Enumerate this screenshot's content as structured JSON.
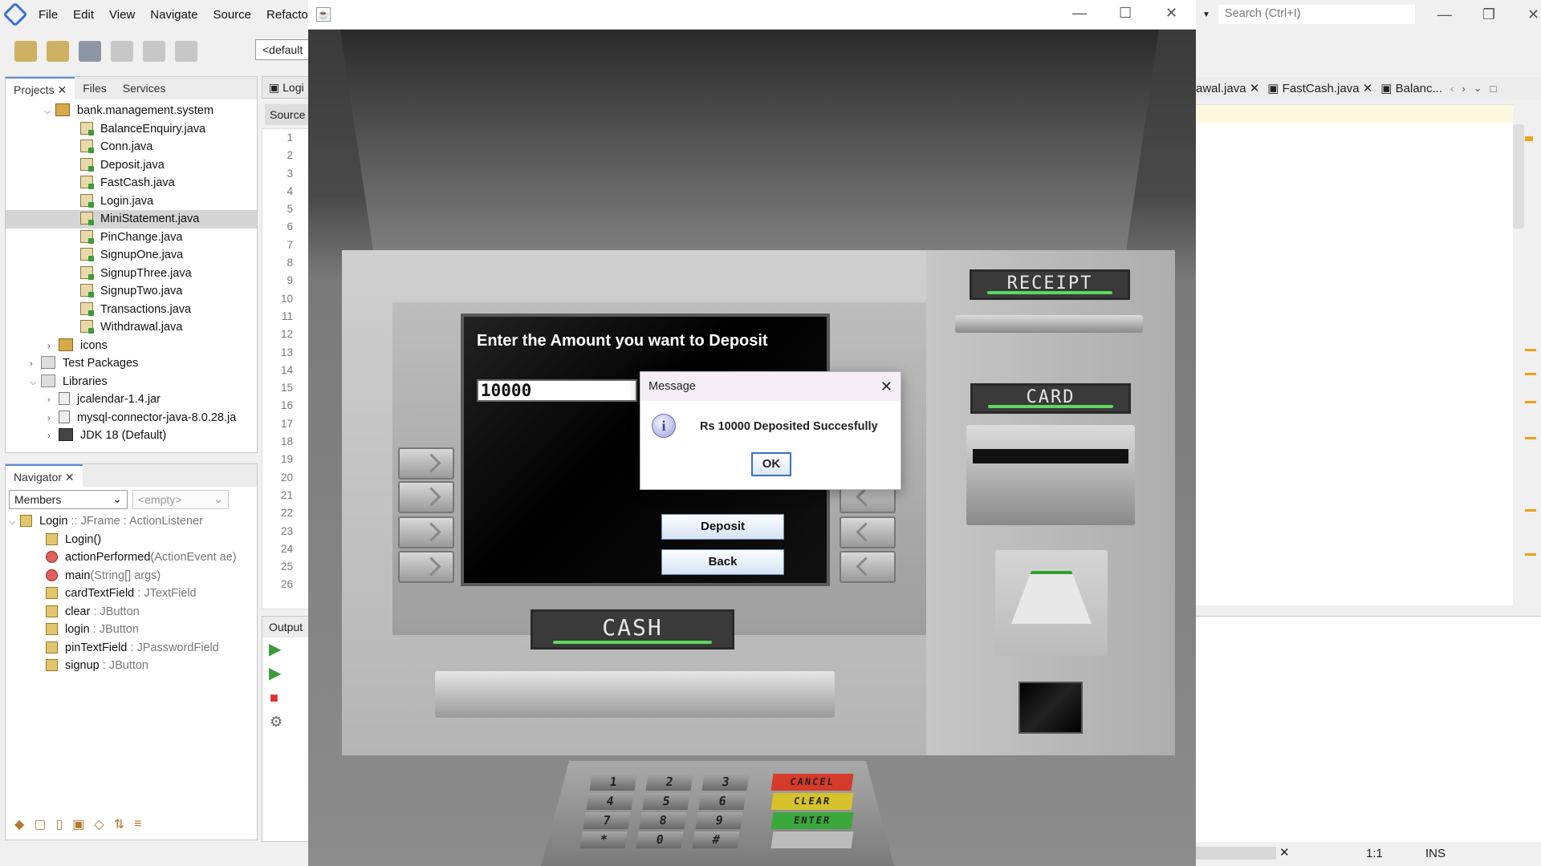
{
  "ide": {
    "menu": [
      "File",
      "Edit",
      "View",
      "Navigate",
      "Source",
      "Refacto"
    ],
    "config_combo": "<default",
    "search_placeholder": "Search (Ctrl+I)",
    "projects_tabs": [
      "Projects",
      "Files",
      "Services"
    ],
    "package_name": "bank.management.system",
    "files": [
      "BalanceEnquiry.java",
      "Conn.java",
      "Deposit.java",
      "FastCash.java",
      "Login.java",
      "MiniStatement.java",
      "PinChange.java",
      "SignupOne.java",
      "SignupThree.java",
      "SignupTwo.java",
      "Transactions.java",
      "Withdrawal.java"
    ],
    "selected_file": "MiniStatement.java",
    "other_nodes": {
      "icons": "icons",
      "test_packages": "Test Packages",
      "libraries": "Libraries",
      "jcalendar": "jcalendar-1.4.jar",
      "mysql": "mysql-connector-java-8.0.28.ja",
      "jdk": "JDK 18 (Default)"
    },
    "navigator": {
      "title": "Navigator",
      "members_combo": "Members",
      "empty_combo": "<empty>",
      "root": {
        "name": "Login",
        "type": " :: JFrame : ActionListener"
      },
      "members": [
        {
          "name": "Login()",
          "type": ""
        },
        {
          "name": "actionPerformed",
          "type": "(ActionEvent ae)"
        },
        {
          "name": "main",
          "type": "(String[] args)"
        },
        {
          "name": "cardTextField",
          "type": " : JTextField"
        },
        {
          "name": "clear",
          "type": " : JButton"
        },
        {
          "name": "login",
          "type": " : JButton"
        },
        {
          "name": "pinTextField",
          "type": " : JPasswordField"
        },
        {
          "name": "signup",
          "type": " : JButton"
        }
      ]
    },
    "editor_tab": "Logi",
    "source_tab": "Source",
    "line_numbers": [
      "1",
      "2",
      "3",
      "4",
      "5",
      "6",
      "7",
      "8",
      "9",
      "10",
      "11",
      "12",
      "13",
      "14",
      "15",
      "16",
      "17",
      "18",
      "19",
      "20",
      "21",
      "22",
      "23",
      "24",
      "25",
      "26"
    ],
    "output_label": "Output",
    "right_tabs": [
      "awal.java",
      "FastCash.java",
      "Balanc..."
    ],
    "status": {
      "position": "1:1",
      "mode": "INS"
    }
  },
  "atm": {
    "prompt": "Enter the Amount you want to Deposit",
    "amount_value": "10000",
    "deposit_button": "Deposit",
    "back_button": "Back",
    "labels": {
      "receipt": "RECEIPT",
      "card": "CARD",
      "cash": "CASH"
    },
    "keys": [
      "1",
      "2",
      "3",
      "4",
      "5",
      "6",
      "7",
      "8",
      "9",
      "*",
      "0",
      "#"
    ],
    "function_keys": [
      {
        "label": "CANCEL",
        "color": "#d63a2a"
      },
      {
        "label": "CLEAR",
        "color": "#d6c22a"
      },
      {
        "label": "ENTER",
        "color": "#3aa83a"
      }
    ]
  },
  "dialog": {
    "title": "Message",
    "message": "Rs 10000 Deposited Succesfully",
    "ok": "OK",
    "icon": "information-icon"
  }
}
